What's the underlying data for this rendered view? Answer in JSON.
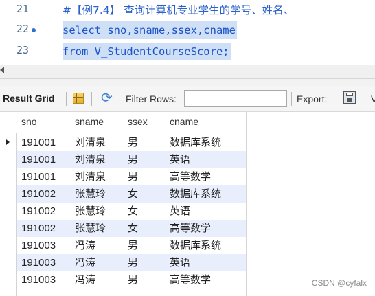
{
  "editor": {
    "lines": [
      {
        "no": "21",
        "text": "#【例7.4】 查询计算机专业学生的学号、姓名、",
        "selected": false
      },
      {
        "no": "22",
        "text": "select sno,sname,ssex,cname",
        "selected": true
      },
      {
        "no": "23",
        "text": "from V_StudentCourseScore;",
        "selected": true
      }
    ]
  },
  "toolbar": {
    "title": "Result Grid",
    "sep": "|",
    "filter_label": "Filter Rows:",
    "filter_value": "",
    "export_label": "Export:",
    "cut_char": "V"
  },
  "grid": {
    "columns": [
      "sno",
      "sname",
      "ssex",
      "cname"
    ],
    "rows": [
      [
        "191001",
        "刘清泉",
        "男",
        "数据库系统"
      ],
      [
        "191001",
        "刘清泉",
        "男",
        "英语"
      ],
      [
        "191001",
        "刘清泉",
        "男",
        "高等数学"
      ],
      [
        "191002",
        "张慧玲",
        "女",
        "数据库系统"
      ],
      [
        "191002",
        "张慧玲",
        "女",
        "英语"
      ],
      [
        "191002",
        "张慧玲",
        "女",
        "高等数学"
      ],
      [
        "191003",
        "冯涛",
        "男",
        "数据库系统"
      ],
      [
        "191003",
        "冯涛",
        "男",
        "英语"
      ],
      [
        "191003",
        "冯涛",
        "男",
        "高等数学"
      ]
    ]
  },
  "watermark": "CSDN @cyfalx",
  "icons": {
    "breakpoint": "breakpoint-dot-icon",
    "grid": "grid-icon",
    "refresh": "refresh-icon",
    "export": "save-export-icon",
    "row_pointer": "row-pointer-icon"
  },
  "colors": {
    "keyword": "#1a52c8",
    "selection": "#cfe0f6",
    "alt_row": "#e8eefb"
  }
}
